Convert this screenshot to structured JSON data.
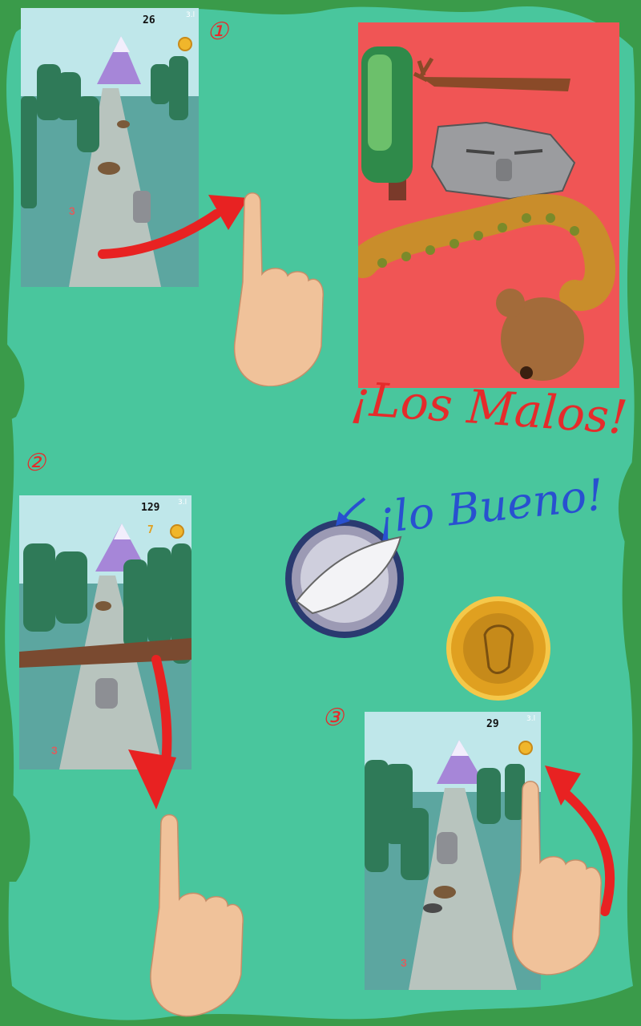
{
  "steps": [
    {
      "label": "①",
      "score": "26",
      "signal": "3.l",
      "gesture": "swipe-right"
    },
    {
      "label": "②",
      "score": "129",
      "signal": "3.l",
      "coins": "7",
      "gesture": "swipe-down"
    },
    {
      "label": "③",
      "score": "29",
      "signal": "3.l",
      "gesture": "swipe-up"
    }
  ],
  "bad_title": "¡Los Malos!",
  "good_title": "¡lo Bueno!",
  "lane_digit": "3",
  "enemies": [
    "tree-icon",
    "branch-icon",
    "stone-face-icon",
    "tentacle-icon",
    "boulder-icon"
  ],
  "goodies": [
    "shell-powerup-icon",
    "gold-coin-icon"
  ],
  "colors": {
    "bad_panel": "#f05555",
    "bad_text": "#e52b2b",
    "good_text": "#2850d0",
    "bg": "#49c69d",
    "border": "#3a9b4a"
  }
}
